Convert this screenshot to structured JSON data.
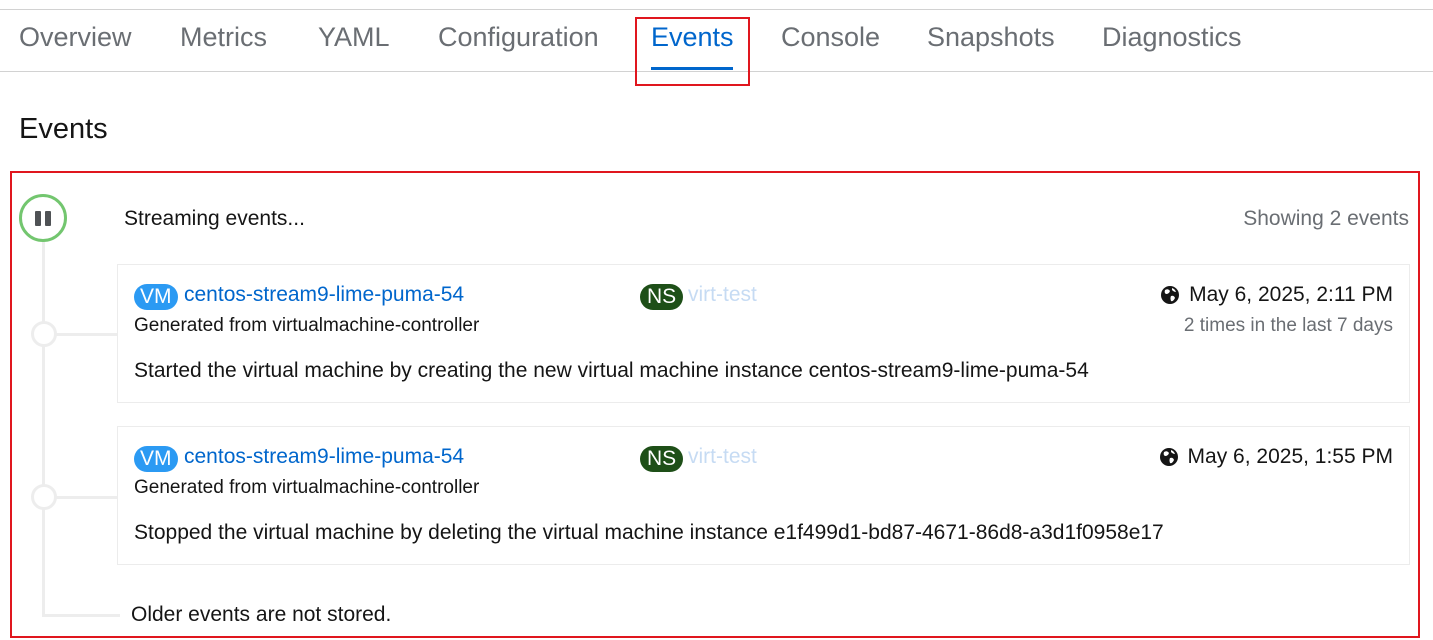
{
  "tabs": [
    {
      "label": "Overview"
    },
    {
      "label": "Metrics"
    },
    {
      "label": "YAML"
    },
    {
      "label": "Configuration"
    },
    {
      "label": "Events",
      "active": true
    },
    {
      "label": "Console"
    },
    {
      "label": "Snapshots"
    },
    {
      "label": "Diagnostics"
    }
  ],
  "page": {
    "title": "Events"
  },
  "stream": {
    "status_text": "Streaming events...",
    "count_text": "Showing 2 events",
    "pause_icon": "pause-icon",
    "status_color": "#73c66f"
  },
  "events": [
    {
      "resource_badge": "VM",
      "resource_name": "centos-stream9-lime-puma-54",
      "namespace_badge": "NS",
      "namespace_name": "virt-test",
      "source": "Generated from virtualmachine-controller",
      "timestamp": "May 6, 2025, 2:11 PM",
      "count": "2 times in the last 7 days",
      "message": "Started the virtual machine by creating the new virtual machine instance centos-stream9-lime-puma-54"
    },
    {
      "resource_badge": "VM",
      "resource_name": "centos-stream9-lime-puma-54",
      "namespace_badge": "NS",
      "namespace_name": "virt-test",
      "source": "Generated from virtualmachine-controller",
      "timestamp": "May 6, 2025, 1:55 PM",
      "count": "",
      "message": "Stopped the virtual machine by deleting the virtual machine instance e1f499d1-bd87-4671-86d8-a3d1f0958e17"
    }
  ],
  "footer": {
    "older_text": "Older events are not stored."
  },
  "colors": {
    "accent": "#0066cc",
    "vm_badge": "#2b9af3",
    "ns_badge": "#1e4f18",
    "highlight": "#e0161e"
  }
}
